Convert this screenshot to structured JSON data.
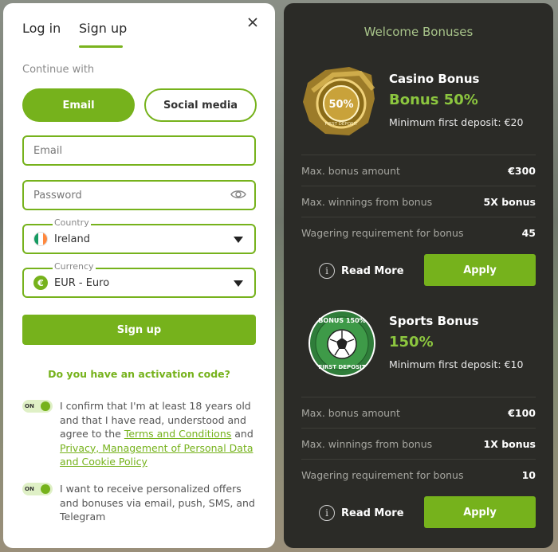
{
  "auth": {
    "tabs": [
      "Log in",
      "Sign up"
    ],
    "active_tab": "Sign up",
    "continue_with": "Continue with",
    "method_email": "Email",
    "method_social": "Social media",
    "email_placeholder": "Email",
    "password_placeholder": "Password",
    "country_label": "Country",
    "country_value": "Ireland",
    "currency_label": "Currency",
    "currency_value": "EUR - Euro",
    "signup_button": "Sign up",
    "activation_link": "Do you have an activation code?",
    "consent_age": {
      "switch_label": "ON",
      "text_before": "I confirm that I'm at least 18 years old and that I have read, understood and agree to the ",
      "terms_link": "Terms and Conditions",
      "and": " and ",
      "privacy_link": "Privacy, Management of Personal Data and Cookie Policy"
    },
    "consent_marketing": {
      "switch_label": "ON",
      "text": "I want to receive personalized offers and bonuses via email, push, SMS, and Telegram"
    }
  },
  "bonuses": {
    "title": "Welcome Bonuses",
    "items": [
      {
        "name": "Casino Bonus",
        "headline": "Bonus 50%",
        "min_deposit": "Minimum first deposit: €20",
        "badge_main": "50%",
        "badge_sub": "FIRST DEPOSIT",
        "rows": [
          {
            "k": "Max. bonus amount",
            "v": "€300"
          },
          {
            "k": "Max. winnings from bonus",
            "v": "5X bonus"
          },
          {
            "k": "Wagering requirement for bonus",
            "v": "45"
          }
        ],
        "read_more": "Read More",
        "apply": "Apply"
      },
      {
        "name": "Sports Bonus",
        "headline": "150%",
        "min_deposit": "Minimum first deposit: €10",
        "badge_main": "BONUS 150%",
        "badge_sub": "FIRST DEPOSIT",
        "rows": [
          {
            "k": "Max. bonus amount",
            "v": "€100"
          },
          {
            "k": "Max. winnings from bonus",
            "v": "1X bonus"
          },
          {
            "k": "Wagering requirement for bonus",
            "v": "10"
          }
        ],
        "read_more": "Read More",
        "apply": "Apply"
      }
    ]
  },
  "colors": {
    "accent": "#76b21c",
    "accent_text": "#8cc63f",
    "dark_panel": "#2b2b27"
  }
}
